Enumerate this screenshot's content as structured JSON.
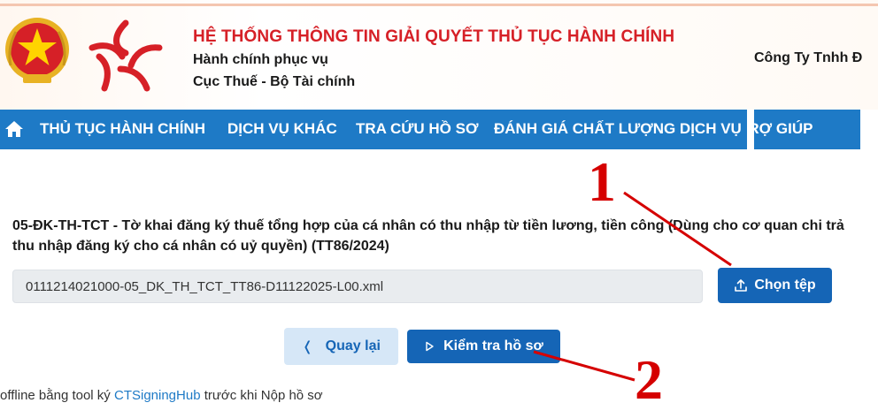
{
  "header": {
    "system_title": "HỆ THỐNG THÔNG TIN GIẢI QUYẾT THỦ TỤC HÀNH CHÍNH",
    "subtitle_1": "Hành chính phục vụ",
    "subtitle_2": "Cục Thuế - Bộ Tài chính",
    "company": "Công Ty Tnhh Đ",
    "emblem_icon": "national-emblem-icon",
    "logo_icon": "tax-star-logo-icon"
  },
  "nav": {
    "home_icon": "home-icon",
    "items": [
      {
        "label": "THỦ TỤC HÀNH CHÍNH"
      },
      {
        "label": "DỊCH VỤ KHÁC"
      },
      {
        "label": "TRA CỨU HỒ SƠ"
      },
      {
        "label": "ĐÁNH GIÁ CHẤT LƯỢNG DỊCH VỤ"
      },
      {
        "label": "TRỢ GIÚP"
      }
    ],
    "color": "#1e7ac6"
  },
  "form": {
    "title": "05-ĐK-TH-TCT - Tờ khai đăng ký thuế tổng hợp của cá nhân có thu nhập từ tiền lương, tiền công (Dùng cho cơ quan chi trả thu nhập đăng ký cho cá nhân có uỷ quyền) (TT86/2024)",
    "file_value": "0111214021000-05_DK_TH_TCT_TT86-D11122025-L00.xml",
    "choose_label": "Chọn tệp",
    "upload_icon": "upload-icon"
  },
  "actions": {
    "back_label": "Quay lại",
    "back_icon": "chevron-left-icon",
    "check_label": "Kiểm tra hồ sơ",
    "check_icon": "play-icon",
    "primary_color": "#1565b6"
  },
  "note": {
    "prefix": "offline bằng tool ký ",
    "link": "CTSigningHub",
    "suffix": " trước khi Nộp hồ sơ"
  },
  "annotations": {
    "step_1": "1",
    "step_2": "2",
    "color": "#d50000"
  }
}
